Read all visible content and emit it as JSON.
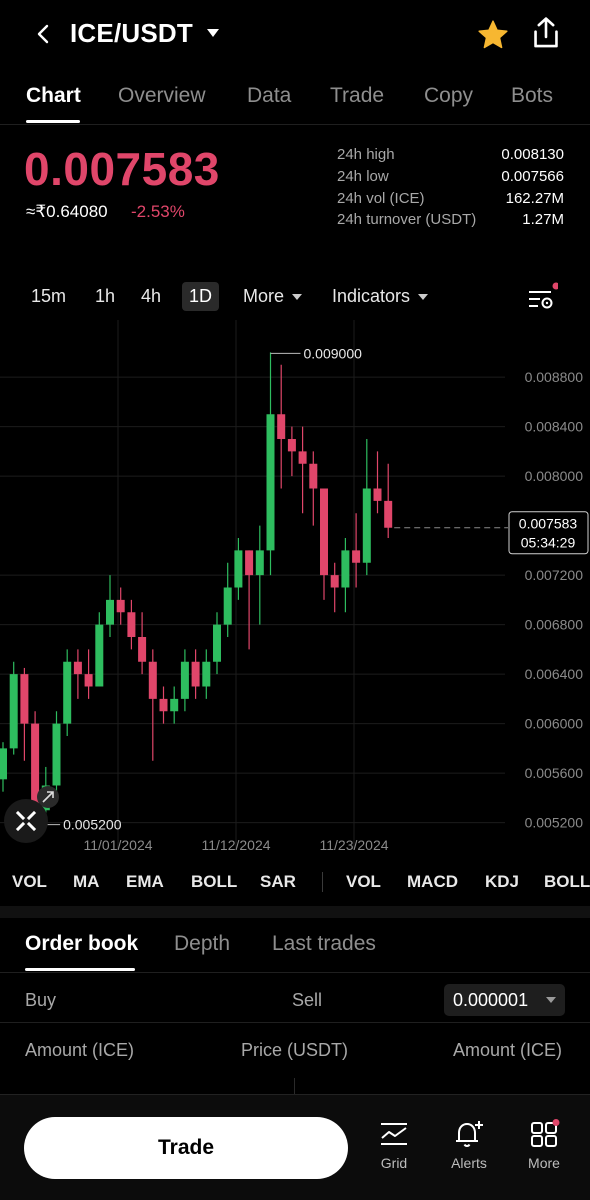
{
  "header": {
    "pair": "ICE/USDT",
    "back_icon": "chevron-left-icon",
    "favorite_icon": "star-icon",
    "share_icon": "share-icon",
    "star_color": "#f7b731"
  },
  "tabs": [
    {
      "label": "Chart",
      "active": true
    },
    {
      "label": "Overview",
      "active": false
    },
    {
      "label": "Data",
      "active": false
    },
    {
      "label": "Trade",
      "active": false
    },
    {
      "label": "Copy",
      "active": false
    },
    {
      "label": "Bots",
      "active": false
    }
  ],
  "ticker": {
    "last_price": "0.007583",
    "fiat_price": "≈₹0.64080",
    "change_pct": "-2.53%",
    "down_color": "#e0466a",
    "up_color": "#2ebd5f",
    "stats": [
      {
        "label": "24h high",
        "value": "0.008130"
      },
      {
        "label": "24h low",
        "value": "0.007566"
      },
      {
        "label": "24h vol (ICE)",
        "value": "162.27M"
      },
      {
        "label": "24h turnover (USDT)",
        "value": "1.27M"
      }
    ]
  },
  "toolbar": {
    "timeframes": [
      "15m",
      "1h",
      "4h",
      "1D"
    ],
    "active_timeframe": "1D",
    "more_label": "More",
    "indicators_label": "Indicators",
    "settings_icon": "chart-settings-icon"
  },
  "chart_data": {
    "type": "candlestick",
    "y_ticks": [
      "0.008800",
      "0.008400",
      "0.008000",
      "0.007200",
      "0.006800",
      "0.006400",
      "0.006000",
      "0.005600",
      "0.005200"
    ],
    "x_ticks": [
      "11/01/2024",
      "11/12/2024",
      "11/23/2024"
    ],
    "ylim": [
      0.0051,
      0.0091
    ],
    "high_label": "0.009000",
    "low_label": "0.005200",
    "current_price_label": "0.007583",
    "countdown_label": "05:34:29",
    "current_price": 0.007583,
    "candles": [
      {
        "o": 0.00555,
        "h": 0.00585,
        "l": 0.00545,
        "c": 0.0058
      },
      {
        "o": 0.0058,
        "h": 0.0065,
        "l": 0.00575,
        "c": 0.0064
      },
      {
        "o": 0.0064,
        "h": 0.00645,
        "l": 0.0057,
        "c": 0.006
      },
      {
        "o": 0.006,
        "h": 0.0061,
        "l": 0.0052,
        "c": 0.0053
      },
      {
        "o": 0.0053,
        "h": 0.00565,
        "l": 0.0052,
        "c": 0.0055
      },
      {
        "o": 0.0055,
        "h": 0.0061,
        "l": 0.0054,
        "c": 0.006
      },
      {
        "o": 0.006,
        "h": 0.0066,
        "l": 0.0059,
        "c": 0.0065
      },
      {
        "o": 0.0065,
        "h": 0.0066,
        "l": 0.0062,
        "c": 0.0064
      },
      {
        "o": 0.0064,
        "h": 0.0066,
        "l": 0.0062,
        "c": 0.0063
      },
      {
        "o": 0.0063,
        "h": 0.0069,
        "l": 0.0063,
        "c": 0.0068
      },
      {
        "o": 0.0068,
        "h": 0.0072,
        "l": 0.0067,
        "c": 0.007
      },
      {
        "o": 0.007,
        "h": 0.0071,
        "l": 0.0068,
        "c": 0.0069
      },
      {
        "o": 0.0069,
        "h": 0.007,
        "l": 0.0066,
        "c": 0.0067
      },
      {
        "o": 0.0067,
        "h": 0.0069,
        "l": 0.0064,
        "c": 0.0065
      },
      {
        "o": 0.0065,
        "h": 0.0066,
        "l": 0.0057,
        "c": 0.0062
      },
      {
        "o": 0.0062,
        "h": 0.0063,
        "l": 0.006,
        "c": 0.0061
      },
      {
        "o": 0.0061,
        "h": 0.0063,
        "l": 0.006,
        "c": 0.0062
      },
      {
        "o": 0.0062,
        "h": 0.0066,
        "l": 0.0061,
        "c": 0.0065
      },
      {
        "o": 0.0065,
        "h": 0.0066,
        "l": 0.0062,
        "c": 0.0063
      },
      {
        "o": 0.0063,
        "h": 0.0066,
        "l": 0.0062,
        "c": 0.0065
      },
      {
        "o": 0.0065,
        "h": 0.0069,
        "l": 0.0064,
        "c": 0.0068
      },
      {
        "o": 0.0068,
        "h": 0.0073,
        "l": 0.0067,
        "c": 0.0071
      },
      {
        "o": 0.0071,
        "h": 0.0075,
        "l": 0.007,
        "c": 0.0074
      },
      {
        "o": 0.0074,
        "h": 0.0074,
        "l": 0.0066,
        "c": 0.0072
      },
      {
        "o": 0.0072,
        "h": 0.0076,
        "l": 0.0068,
        "c": 0.0074
      },
      {
        "o": 0.0074,
        "h": 0.009,
        "l": 0.0072,
        "c": 0.0085
      },
      {
        "o": 0.0085,
        "h": 0.0089,
        "l": 0.0079,
        "c": 0.0083
      },
      {
        "o": 0.0083,
        "h": 0.0084,
        "l": 0.008,
        "c": 0.0082
      },
      {
        "o": 0.0082,
        "h": 0.0084,
        "l": 0.0077,
        "c": 0.0081
      },
      {
        "o": 0.0081,
        "h": 0.0082,
        "l": 0.0076,
        "c": 0.0079
      },
      {
        "o": 0.0079,
        "h": 0.0079,
        "l": 0.007,
        "c": 0.0072
      },
      {
        "o": 0.0072,
        "h": 0.0073,
        "l": 0.0069,
        "c": 0.0071
      },
      {
        "o": 0.0071,
        "h": 0.0075,
        "l": 0.0069,
        "c": 0.0074
      },
      {
        "o": 0.0074,
        "h": 0.0077,
        "l": 0.0071,
        "c": 0.0073
      },
      {
        "o": 0.0073,
        "h": 0.0083,
        "l": 0.0072,
        "c": 0.0079
      },
      {
        "o": 0.0079,
        "h": 0.0082,
        "l": 0.0077,
        "c": 0.0078
      },
      {
        "o": 0.0078,
        "h": 0.0081,
        "l": 0.0075,
        "c": 0.007583
      }
    ]
  },
  "indicators": {
    "main": [
      "VOL",
      "MA",
      "EMA",
      "BOLL",
      "SAR"
    ],
    "sub": [
      "VOL",
      "MACD",
      "KDJ",
      "BOLL"
    ]
  },
  "orderbook": {
    "tabs": [
      {
        "label": "Order book",
        "active": true
      },
      {
        "label": "Depth",
        "active": false
      },
      {
        "label": "Last trades",
        "active": false
      }
    ],
    "buy_label": "Buy",
    "sell_label": "Sell",
    "tick_size": "0.000001",
    "columns": [
      "Amount (ICE)",
      "Price (USDT)",
      "Amount (ICE)"
    ]
  },
  "bottom_bar": {
    "trade_label": "Trade",
    "nav": [
      {
        "label": "Grid",
        "icon": "grid-chart-icon"
      },
      {
        "label": "Alerts",
        "icon": "bell-plus-icon"
      },
      {
        "label": "More",
        "icon": "apps-icon"
      }
    ]
  }
}
